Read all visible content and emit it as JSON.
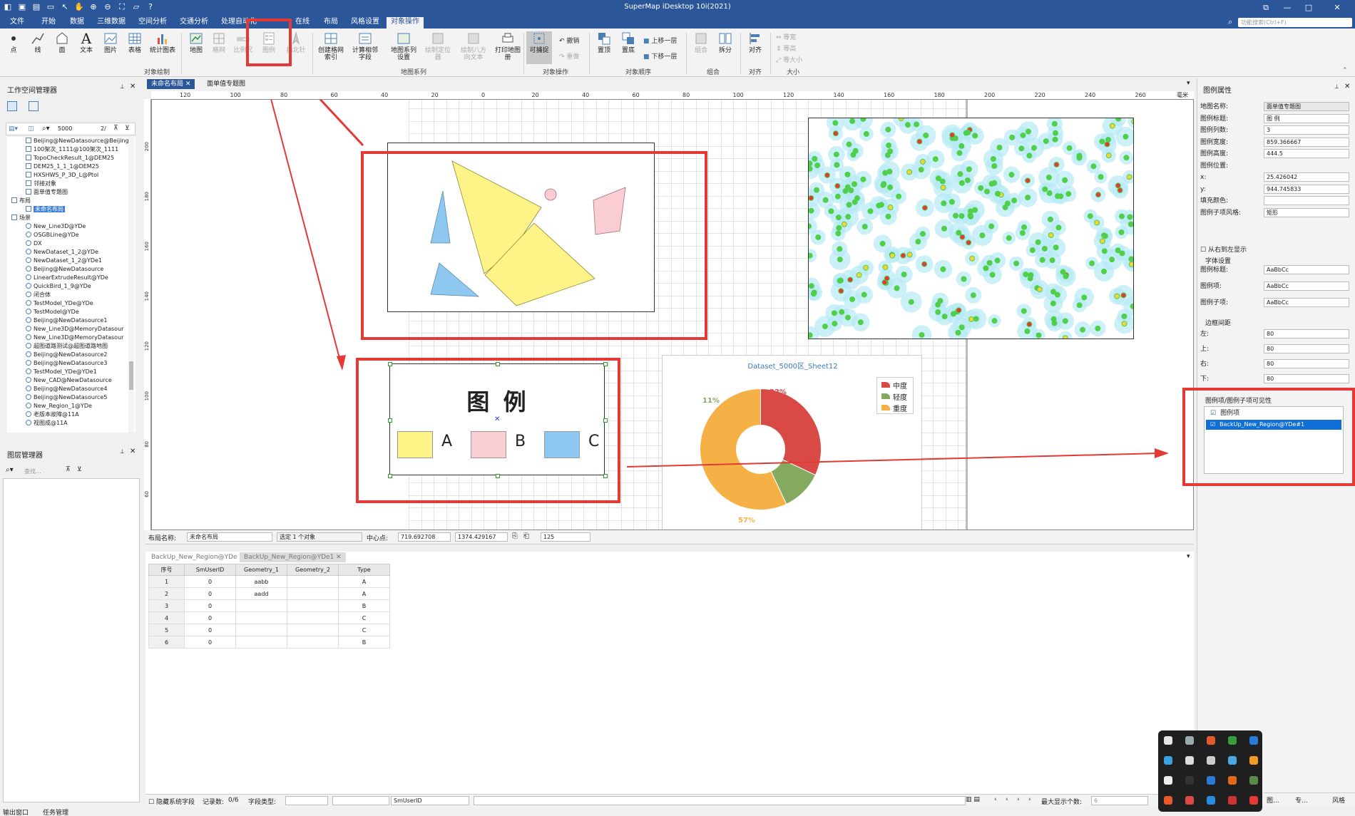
{
  "window": {
    "title": "SuperMap iDesktop 10i(2021)"
  },
  "menubar": {
    "items": [
      "文件",
      "开始",
      "数据",
      "三维数据",
      "空间分析",
      "交通分析",
      "处理自动化",
      "在线",
      "布局",
      "风格设置",
      "对象操作"
    ]
  },
  "ribbon": {
    "draw_buttons": [
      "点",
      "线",
      "面",
      "文本",
      "图片",
      "表格",
      "统计图表"
    ],
    "map_buttons": [
      "地图",
      "格网",
      "比例尺",
      "图例",
      "指北针"
    ],
    "series_buttons": [
      "创建格网索引",
      "计算相邻字段",
      "地图系列设置",
      "绘制定位器",
      "绘制八方向文本",
      "打印地图册"
    ],
    "capture_button": "可捕捉",
    "undo": "撤销",
    "redo": "重做",
    "order_buttons": [
      "置顶",
      "置底"
    ],
    "move_up": "上移一层",
    "move_down": "下移一层",
    "combine": "组合",
    "split": "拆分",
    "align": "对齐",
    "size_items": [
      "等宽",
      "等高",
      "等大小"
    ],
    "groups": [
      "对象绘制",
      "地图系列",
      "对象操作",
      "对象顺序",
      "组合",
      "对齐",
      "大小"
    ],
    "search_placeholder": "功能搜索(Ctrl+F)"
  },
  "workspace": {
    "title": "工作空间管理器",
    "search_value": "5000",
    "page_indicator": "2/",
    "tree": [
      {
        "label": "Beijing@NewDatasource@Beijing",
        "kind": "item"
      },
      {
        "label": "100架次_1111@100架次_1111",
        "kind": "item"
      },
      {
        "label": "TopoCheckResult_1@DEM25",
        "kind": "item"
      },
      {
        "label": "DEM25_1_1_1@DEM25",
        "kind": "item"
      },
      {
        "label": "HXSHWS_P_3D_L@Ptol",
        "kind": "item"
      },
      {
        "label": "邻接对象",
        "kind": "item"
      },
      {
        "label": "面单值专题图",
        "kind": "item"
      },
      {
        "label": "布局",
        "kind": "group"
      },
      {
        "label": "未命名布局",
        "kind": "selected"
      },
      {
        "label": "场景",
        "kind": "group"
      },
      {
        "label": "New_Line3D@YDe",
        "kind": "scene"
      },
      {
        "label": "OSGBLine@YDe",
        "kind": "scene"
      },
      {
        "label": "DX",
        "kind": "scene"
      },
      {
        "label": "NewDataset_1_2@YDe",
        "kind": "scene"
      },
      {
        "label": "NewDataset_1_2@YDe1",
        "kind": "scene"
      },
      {
        "label": "Beijing@NewDatasource",
        "kind": "scene"
      },
      {
        "label": "LinearExtrudeResult@YDe",
        "kind": "scene"
      },
      {
        "label": "QuickBird_1_9@YDe",
        "kind": "scene"
      },
      {
        "label": "闭合体",
        "kind": "scene"
      },
      {
        "label": "TestModel_YDe@YDe",
        "kind": "scene"
      },
      {
        "label": "TestModel@YDe",
        "kind": "scene"
      },
      {
        "label": "Beijing@NewDatasource1",
        "kind": "scene"
      },
      {
        "label": "New_Line3D@MemoryDatasour",
        "kind": "scene"
      },
      {
        "label": "New_Line3D@MemoryDatasour",
        "kind": "scene"
      },
      {
        "label": "超图道路测试@超图道路地图",
        "kind": "scene"
      },
      {
        "label": "Beijing@NewDatasource2",
        "kind": "scene"
      },
      {
        "label": "Beijing@NewDatasource3",
        "kind": "scene"
      },
      {
        "label": "TestModel_YDe@YDe1",
        "kind": "scene"
      },
      {
        "label": "New_CAD@NewDatasource",
        "kind": "scene"
      },
      {
        "label": "Beijing@NewDatasource4",
        "kind": "scene"
      },
      {
        "label": "Beijing@NewDatasource5",
        "kind": "scene"
      },
      {
        "label": "New_Region_1@YDe",
        "kind": "scene"
      },
      {
        "label": "老版本故障@11A",
        "kind": "scene"
      },
      {
        "label": "视图成@11A",
        "kind": "scene"
      }
    ]
  },
  "layers": {
    "title": "图层管理器",
    "search_placeholder": "查找..."
  },
  "tabs": {
    "doc": [
      "未命名布局",
      "面单值专题图"
    ],
    "attr": [
      "BackUp_New_Region@YDe",
      "BackUp_New_Region@YDe1"
    ]
  },
  "ruler": {
    "top": [
      "120",
      "100",
      "80",
      "60",
      "40",
      "20",
      "0",
      "20",
      "40",
      "60",
      "80",
      "100",
      "120",
      "140",
      "160",
      "180",
      "200",
      "220",
      "240",
      "260"
    ],
    "left": [
      "200",
      "180",
      "160",
      "140",
      "120",
      "100",
      "80",
      "60"
    ],
    "unit": "毫米"
  },
  "legend": {
    "title": "图  例",
    "items": [
      {
        "label": "A",
        "color": "#fdf386"
      },
      {
        "label": "B",
        "color": "#f9cdd3"
      },
      {
        "label": "C",
        "color": "#8ec7f0"
      }
    ]
  },
  "pie": {
    "title": "Dataset_5000区_Sheet12",
    "legend": [
      "中度",
      "轻度",
      "重度"
    ],
    "labels": [
      "32%",
      "11%",
      "57%"
    ]
  },
  "chart_data": {
    "type": "pie",
    "title": "Dataset_5000区_Sheet12",
    "categories": [
      "中度",
      "轻度",
      "重度"
    ],
    "values": [
      32,
      11,
      57
    ],
    "colors": [
      "#d94a47",
      "#86a960",
      "#f5b145"
    ],
    "legend": "top-right"
  },
  "properties": {
    "title": "图例属性",
    "rows": [
      {
        "label": "地图名称:",
        "value": "面单值专题图"
      },
      {
        "label": "图例标题:",
        "value": "图  例"
      },
      {
        "label": "图例列数:",
        "value": "3"
      },
      {
        "label": "图例宽度:",
        "value": "859.366667"
      },
      {
        "label": "图例高度:",
        "value": "444.5"
      },
      {
        "label": "图例位置:",
        "value": ""
      },
      {
        "label": "x:",
        "value": "25.426042"
      },
      {
        "label": "y:",
        "value": "944.745833"
      },
      {
        "label": "填充颜色:",
        "value": ""
      },
      {
        "label": "图例子项风格:",
        "value": "矩形"
      }
    ],
    "rtl_label": "从右到左显示",
    "font_section": "字体设置",
    "font_rows": [
      {
        "label": "图例标题:",
        "value": "AaBbCc"
      },
      {
        "label": "图例项:",
        "value": "AaBbCc"
      },
      {
        "label": "图例子项:",
        "value": "AaBbCc"
      }
    ],
    "margin_section": "边框间距",
    "margin_rows": [
      {
        "label": "左:",
        "value": "80"
      },
      {
        "label": "上:",
        "value": "80"
      },
      {
        "label": "右:",
        "value": "80"
      },
      {
        "label": "下:",
        "value": "80"
      }
    ],
    "visibility_section": "图例项/图例子项可见性",
    "visibility_items": [
      "图例项",
      "BackUp_New_Region@YDe#1"
    ]
  },
  "layout_status": {
    "name_label": "布局名称:",
    "name_value": "未命名布局",
    "selection": "选定 1 个对象",
    "center_label": "中心点:",
    "cx": "719.692708",
    "cy": "1374.429167",
    "zoom": "125"
  },
  "table": {
    "headers": [
      "序号",
      "SmUserID",
      "Geometry_1",
      "Geometry_2",
      "Type"
    ],
    "rows": [
      [
        "1",
        "0",
        "aabb",
        "",
        "A"
      ],
      [
        "2",
        "0",
        "aadd",
        "",
        "A"
      ],
      [
        "3",
        "0",
        "",
        "",
        "B"
      ],
      [
        "4",
        "0",
        "",
        "",
        "C"
      ],
      [
        "5",
        "0",
        "",
        "",
        "C"
      ],
      [
        "6",
        "0",
        "",
        "",
        "B"
      ]
    ]
  },
  "statusbar": {
    "hide_system": "隐藏系统字段",
    "record_label": "记录数:",
    "record_value": "0/6",
    "field_type_label": "字段类型:",
    "field_value": "SmUserID",
    "max_display_label": "最大显示个数:",
    "max_display_value": "6"
  },
  "bottom_tabs": [
    "输出窗口",
    "任务管理"
  ],
  "side_tabs": [
    "图...",
    "专...",
    "风格"
  ]
}
